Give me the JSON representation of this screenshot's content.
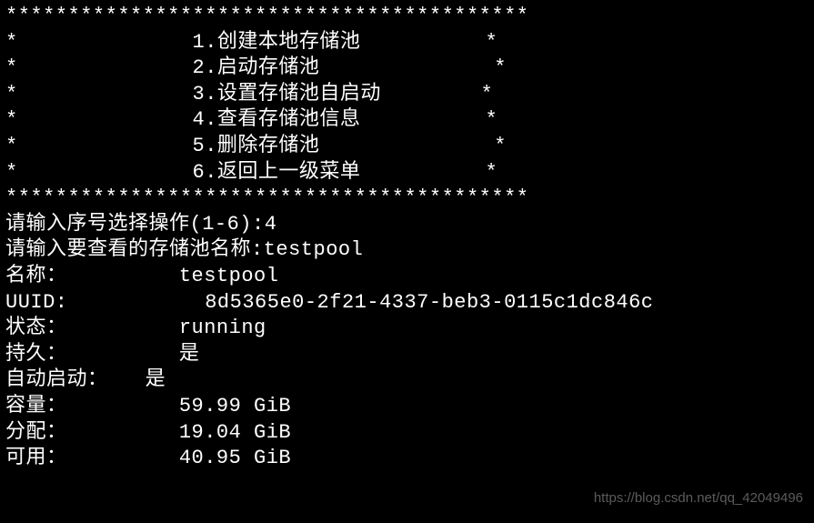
{
  "border_top": "******************************************",
  "menu": {
    "items": [
      {
        "num": "1",
        "label": "创建本地存储池"
      },
      {
        "num": "2",
        "label": "启动存储池"
      },
      {
        "num": "3",
        "label": "设置存储池自启动"
      },
      {
        "num": "4",
        "label": "查看存储池信息"
      },
      {
        "num": "5",
        "label": "删除存储池"
      },
      {
        "num": "6",
        "label": "返回上一级菜单"
      }
    ]
  },
  "border_bottom": "******************************************",
  "prompts": {
    "select_op": "请输入序号选择操作(1-6):",
    "select_op_value": "4",
    "pool_name": "请输入要查看的存储池名称:",
    "pool_name_value": "testpool"
  },
  "pool_info": {
    "name_label": "名称：",
    "name_value": "testpool",
    "uuid_label": "UUID:",
    "uuid_value": "8d5365e0-2f21-4337-beb3-0115c1dc846c",
    "state_label": "状态：",
    "state_value": "running",
    "persistent_label": "持久：",
    "persistent_value": "是",
    "autostart_label": "自动启动：",
    "autostart_value": "是",
    "capacity_label": "容量：",
    "capacity_value": "59.99 GiB",
    "allocated_label": "分配：",
    "allocated_value": "19.04 GiB",
    "available_label": "可用：",
    "available_value": "40.95 GiB"
  },
  "watermark": "https://blog.csdn.net/qq_42049496"
}
